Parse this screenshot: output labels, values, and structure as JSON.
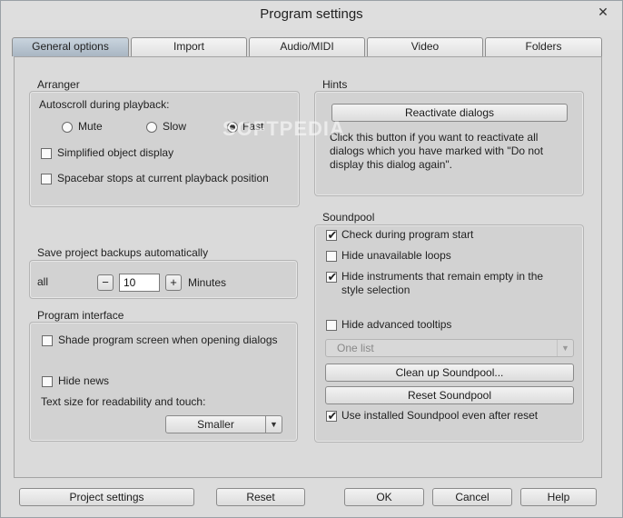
{
  "window": {
    "title": "Program settings",
    "close_glyph": "✕",
    "watermark": "SOFTPEDIA"
  },
  "tabs": [
    {
      "label": "General options",
      "active": true
    },
    {
      "label": "Import",
      "active": false
    },
    {
      "label": "Audio/MIDI",
      "active": false
    },
    {
      "label": "Video",
      "active": false
    },
    {
      "label": "Folders",
      "active": false
    }
  ],
  "arranger": {
    "title": "Arranger",
    "autoscroll_label": "Autoscroll during playback:",
    "radio_options": [
      {
        "label": "Mute",
        "selected": false
      },
      {
        "label": "Slow",
        "selected": false
      },
      {
        "label": "Fast",
        "selected": true
      }
    ],
    "simplified_display": {
      "label": "Simplified object display",
      "checked": false
    },
    "spacebar_stops": {
      "label": "Spacebar stops at current playback position",
      "checked": false
    }
  },
  "hints": {
    "title": "Hints",
    "reactivate_button": "Reactivate dialogs",
    "description": "Click this button if you want to reactivate all dialogs which you have marked with \"Do not display this dialog again\"."
  },
  "backups": {
    "title": "Save project backups automatically",
    "prefix": "all",
    "minus": "−",
    "plus": "+",
    "value": "10",
    "unit": "Minutes"
  },
  "program_interface": {
    "title": "Program interface",
    "shade_screen": {
      "label": "Shade program screen when opening dialogs",
      "checked": false
    },
    "hide_news": {
      "label": "Hide news",
      "checked": false
    },
    "text_size_label": "Text size for readability and touch:",
    "text_size_value": "Smaller"
  },
  "soundpool": {
    "title": "Soundpool",
    "check_start": {
      "label": "Check during program start",
      "checked": true
    },
    "hide_unavailable": {
      "label": "Hide unavailable loops",
      "checked": false
    },
    "hide_empty": {
      "label": "Hide instruments that remain empty in the style selection",
      "checked": true
    },
    "hide_tooltips": {
      "label": "Hide advanced tooltips",
      "checked": false
    },
    "list_mode": "One list",
    "clean_up_button": "Clean up Soundpool...",
    "reset_button": "Reset Soundpool",
    "use_installed": {
      "label": "Use installed Soundpool even after reset",
      "checked": true
    }
  },
  "footer": {
    "project_settings": "Project settings",
    "reset": "Reset",
    "ok": "OK",
    "cancel": "Cancel",
    "help": "Help"
  },
  "colors": {
    "active_tab": "#b4c1cd",
    "window_bg": "#dcdcdc",
    "group_bg": "#d2d2d2"
  },
  "icons": {
    "close": "close-icon",
    "dropdown": "chevron-down-icon",
    "check": "checkmark-icon"
  }
}
